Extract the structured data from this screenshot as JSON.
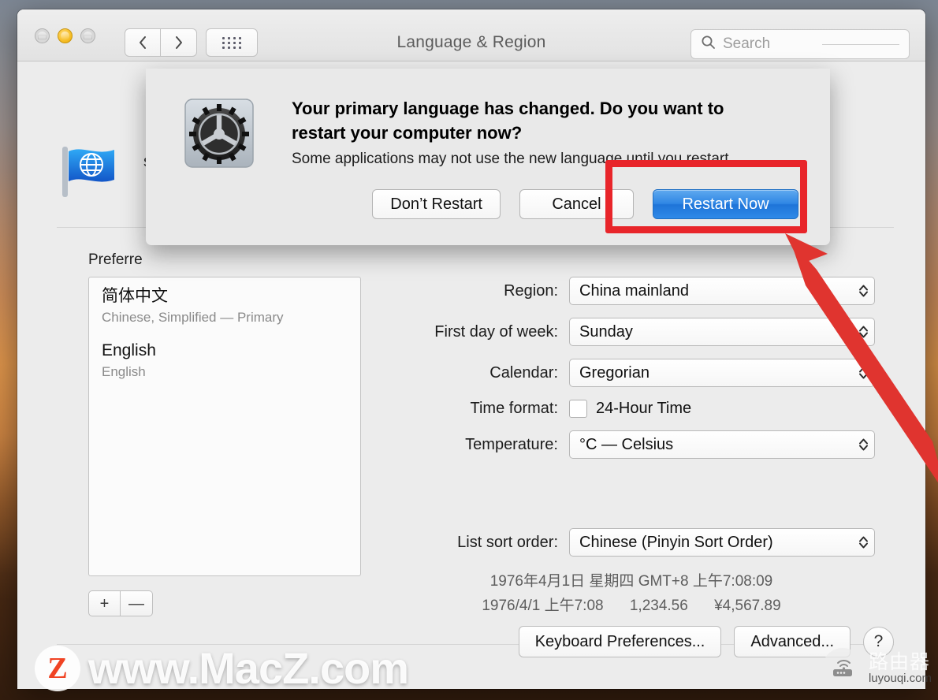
{
  "window": {
    "title": "Language & Region",
    "traffic_lights": [
      "close",
      "minimize",
      "zoom"
    ],
    "nav": {
      "back": "back-arrow",
      "forward": "forward-arrow",
      "grid": "show-all-grid"
    },
    "search": {
      "placeholder": "Search",
      "value": ""
    }
  },
  "pane": {
    "icon": "language-region-flag-globe-icon",
    "description_visible_fragment": "s,",
    "preferred_label": "Preferre",
    "preferred_label_full": "Preferred languages:",
    "languages": [
      {
        "name": "简体中文",
        "subtitle": "Chinese, Simplified — Primary"
      },
      {
        "name": "English",
        "subtitle": "English"
      }
    ],
    "list_buttons": {
      "add": "+",
      "remove": "—"
    }
  },
  "form": {
    "rows": [
      {
        "label": "Region:",
        "value": "China mainland",
        "control": "popup",
        "obscured": true
      },
      {
        "label": "First day of week:",
        "value": "Sunday",
        "control": "popup"
      },
      {
        "label": "Calendar:",
        "value": "Gregorian",
        "control": "popup"
      },
      {
        "label": "Time format:",
        "value": "24-Hour Time",
        "control": "checkbox",
        "checked": false
      },
      {
        "label": "Temperature:",
        "value": "°C — Celsius",
        "control": "popup"
      },
      {
        "label": "List sort order:",
        "value": "Chinese (Pinyin Sort Order)",
        "control": "popup"
      }
    ],
    "preview": {
      "line1": "1976年4月1日 星期四 GMT+8 上午7:08:09",
      "line2_date": "1976/4/1 上午7:08",
      "line2_number": "1,234.56",
      "line2_currency": "¥4,567.89"
    }
  },
  "bottom": {
    "keyboard_prefs": "Keyboard Preferences...",
    "advanced": "Advanced...",
    "help": "?"
  },
  "alert": {
    "icon": "gear-preferences-icon",
    "title": "Your primary language has changed. Do you want to restart your computer now?",
    "body": "Some applications may not use the new language until you restart.",
    "buttons": [
      {
        "label": "Don’t Restart",
        "style": "default"
      },
      {
        "label": "Cancel",
        "style": "default"
      },
      {
        "label": "Restart Now",
        "style": "primary"
      }
    ]
  },
  "annotation": {
    "highlight_color": "#e8252a",
    "highlight_target": "Restart Now",
    "arrow": "red-arrow-pointing-to-restart-now"
  },
  "watermarks": {
    "primary": {
      "text": "www.MacZ.com",
      "badge": "Z"
    },
    "secondary": {
      "cn": "路由器",
      "en": "luyouqi.com",
      "icon": "router-icon"
    }
  }
}
